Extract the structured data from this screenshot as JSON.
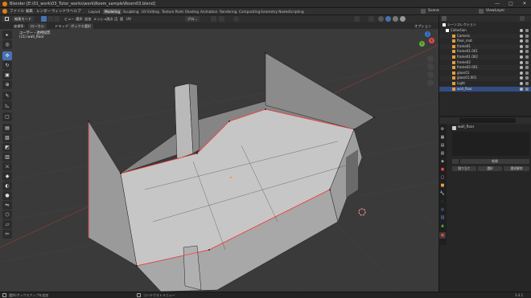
{
  "window": {
    "title": "Blender [E:\\01_work\\03_Tutor_works\\work\\Room_sample\\Room03.blend]",
    "controls": [
      "—",
      "□",
      "✕"
    ]
  },
  "menu": {
    "items": [
      "ファイル",
      "編集",
      "レンダー",
      "ウィンドウ",
      "ヘルプ"
    ],
    "workspaces": [
      "Layout",
      "Modeling",
      "Sculpting",
      "UV Editing",
      "Texture Paint",
      "Shading",
      "Animation",
      "Rendering",
      "Compositing",
      "Geometry Nodes",
      "Scripting"
    ],
    "active_workspace": "Modeling",
    "scene": "Scene",
    "view_layer": "ViewLayer"
  },
  "header": {
    "mode": "編集モード",
    "view_menu": [
      "ビュー",
      "選択",
      "追加",
      "メッシュ",
      "頂点",
      "辺",
      "面",
      "UV"
    ],
    "orientation": "グロ...",
    "options": "オプション"
  },
  "header2": {
    "transform_label": "座標系:",
    "orientation": "ローカル",
    "drag": "ドラッグ:",
    "drag_value": "ボックス選択"
  },
  "viewport": {
    "view_label": "ユーザー・透視投影",
    "object_label": "(11) wall_floor",
    "gizmo": {
      "x": "X",
      "y": "Y",
      "z": "Z"
    }
  },
  "outliner": {
    "title": "シーンコレクション",
    "rows": [
      {
        "label": "Collection",
        "indent": 0,
        "selected": false
      },
      {
        "label": "Camera",
        "indent": 1,
        "selected": false
      },
      {
        "label": "floor_mat",
        "indent": 1,
        "selected": false
      },
      {
        "label": "frame01",
        "indent": 1,
        "selected": false
      },
      {
        "label": "frame01.001",
        "indent": 1,
        "selected": false
      },
      {
        "label": "frame01.002",
        "indent": 1,
        "selected": false
      },
      {
        "label": "frame02",
        "indent": 1,
        "selected": false
      },
      {
        "label": "frame02.001",
        "indent": 1,
        "selected": false
      },
      {
        "label": "glass01",
        "indent": 1,
        "selected": false
      },
      {
        "label": "glass01.001",
        "indent": 1,
        "selected": false
      },
      {
        "label": "Light",
        "indent": 1,
        "selected": false
      },
      {
        "label": "wall_floor",
        "indent": 1,
        "selected": true
      }
    ]
  },
  "properties": {
    "object": "wall_floor",
    "slot_label": "新規",
    "buttons": [
      "割り当て",
      "選択",
      "選択解除"
    ]
  },
  "statusbar": {
    "left": "選択/ボックスアップを追加",
    "middle": "コンテクストメニュー",
    "version": "3.4.1"
  },
  "colors": {
    "accent": "#4772b3",
    "active_tab": "#474747",
    "edge_sel": "#ff3b3b"
  }
}
